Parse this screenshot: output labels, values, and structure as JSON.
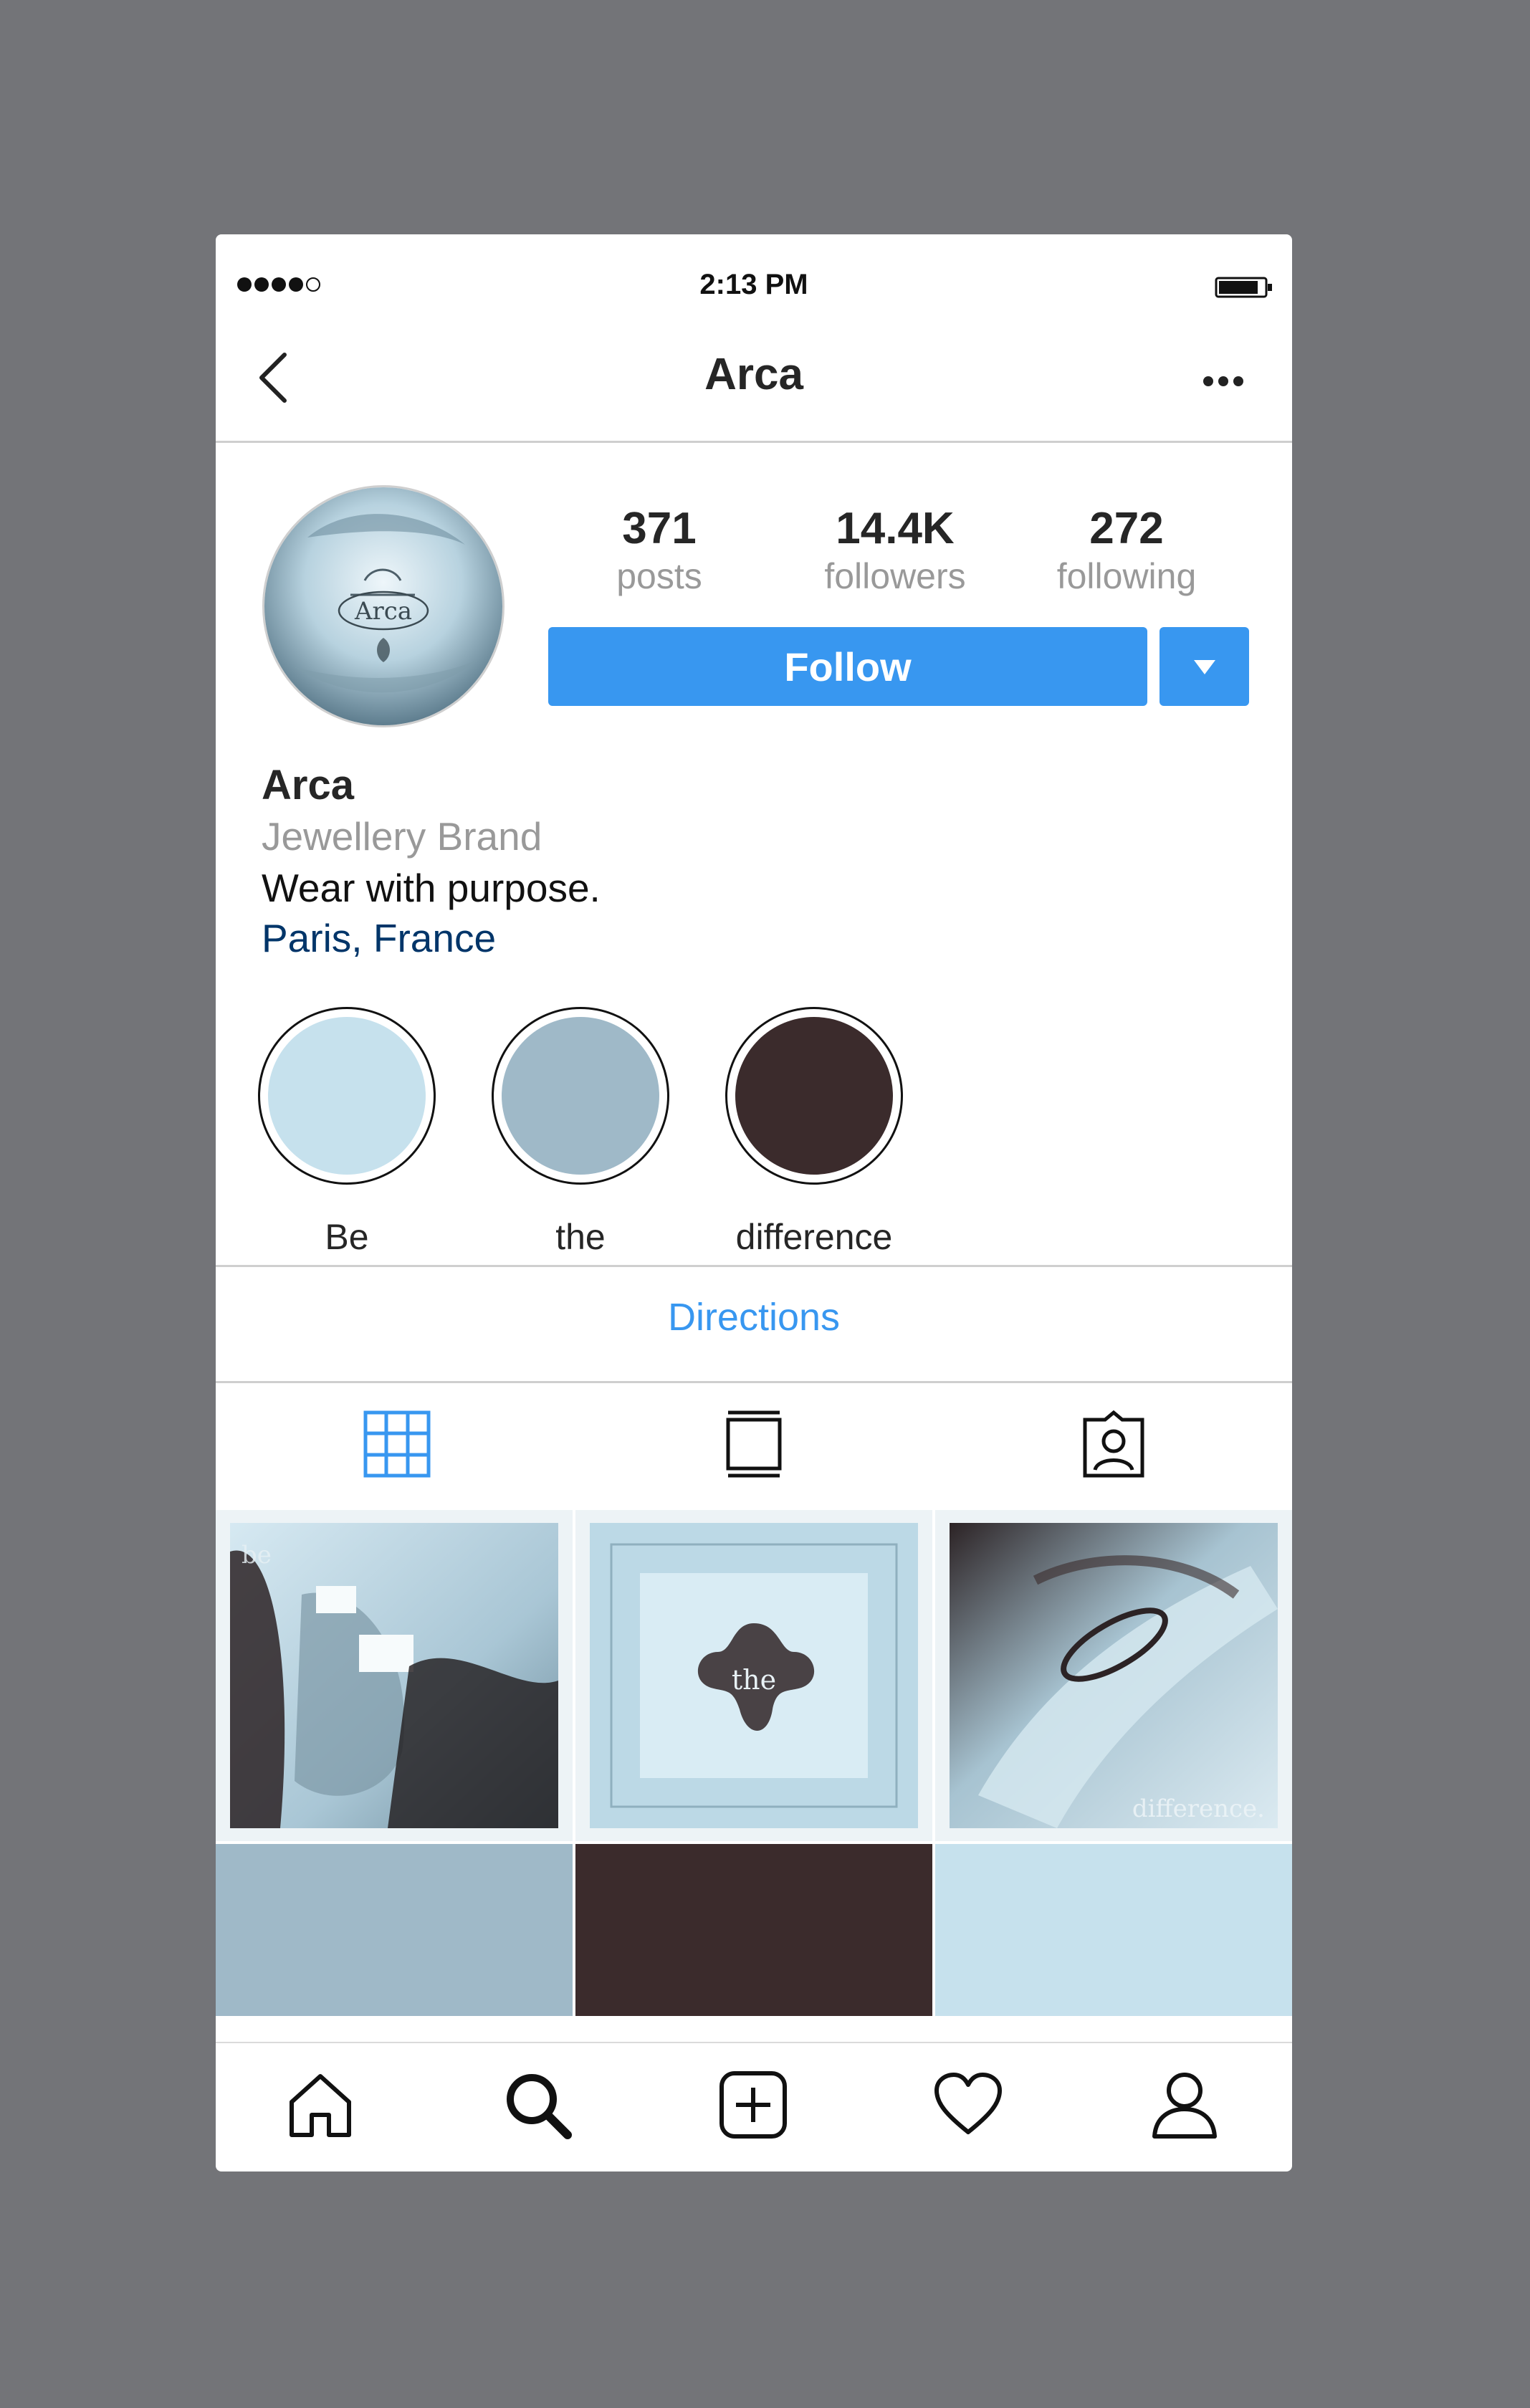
{
  "status_bar": {
    "time": "2:13 PM",
    "signal_bars": 4
  },
  "nav": {
    "title": "Arca",
    "back_icon": "chevron-left-icon",
    "more_icon": "more-dots-icon"
  },
  "profile": {
    "avatar_text": "Arca",
    "stats": [
      {
        "value": "371",
        "label": "posts"
      },
      {
        "value": "14.4K",
        "label": "followers"
      },
      {
        "value": "272",
        "label": "following"
      }
    ],
    "follow_label": "Follow",
    "name": "Arca",
    "category": "Jewellery Brand",
    "bio": "Wear with purpose.",
    "location": "Paris, France"
  },
  "highlights": [
    {
      "label": "Be",
      "color": "#c6e1ed"
    },
    {
      "label": "the",
      "color": "#9fb9c8"
    },
    {
      "label": "difference",
      "color": "#3b2b2c"
    }
  ],
  "directions_label": "Directions",
  "tabs": [
    "grid-icon",
    "feed-icon",
    "tagged-icon"
  ],
  "posts": [
    {
      "caption": "be"
    },
    {
      "caption": "the"
    },
    {
      "caption": "difference."
    },
    {
      "color": "#9fb9c8"
    },
    {
      "color": "#3b2b2c"
    },
    {
      "color": "#c6e1ed"
    }
  ],
  "bottom_nav": [
    "home-icon",
    "search-icon",
    "add-post-icon",
    "heart-icon",
    "profile-icon"
  ],
  "colors": {
    "accent": "#3897f0",
    "link": "#003569",
    "pale_blue": "#c6e1ed",
    "steel_blue": "#9fb9c8",
    "dark_brown": "#3b2b2c",
    "backdrop": "#737478"
  }
}
